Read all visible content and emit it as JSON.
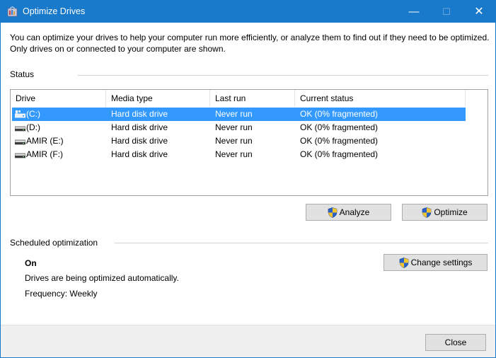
{
  "window": {
    "title": "Optimize Drives",
    "icon": "optimize-drives-icon",
    "controls": {
      "minimize": "—",
      "maximize": "☐",
      "close": "✕"
    }
  },
  "intro_text": "You can optimize your drives to help your computer run more efficiently, or analyze them to find out if they need to be optimized. Only drives on or connected to your computer are shown.",
  "status": {
    "label": "Status",
    "columns": [
      "Drive",
      "Media type",
      "Last run",
      "Current status"
    ],
    "rows": [
      {
        "drive": "(C:)",
        "media_type": "Hard disk drive",
        "last_run": "Never run",
        "current_status": "OK (0% fragmented)",
        "selected": true,
        "icon": "system-drive-icon"
      },
      {
        "drive": "(D:)",
        "media_type": "Hard disk drive",
        "last_run": "Never run",
        "current_status": "OK (0% fragmented)",
        "selected": false,
        "icon": "hard-drive-icon"
      },
      {
        "drive": "AMIR (E:)",
        "media_type": "Hard disk drive",
        "last_run": "Never run",
        "current_status": "OK (0% fragmented)",
        "selected": false,
        "icon": "hard-drive-icon"
      },
      {
        "drive": "AMIR (F:)",
        "media_type": "Hard disk drive",
        "last_run": "Never run",
        "current_status": "OK (0% fragmented)",
        "selected": false,
        "icon": "hard-drive-icon"
      }
    ],
    "buttons": {
      "analyze": "Analyze",
      "optimize": "Optimize"
    }
  },
  "scheduled": {
    "label": "Scheduled optimization",
    "state": "On",
    "description": "Drives are being optimized automatically.",
    "frequency": "Frequency: Weekly",
    "change_settings": "Change settings"
  },
  "footer": {
    "close": "Close"
  },
  "colors": {
    "titlebar": "#1979ca",
    "selection": "#3399ff",
    "button_face": "#e1e1e1",
    "footer": "#f0f0f0"
  }
}
